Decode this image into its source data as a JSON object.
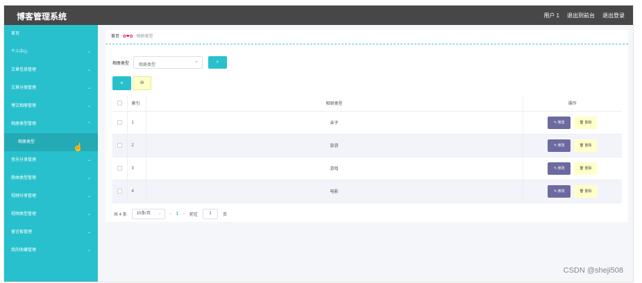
{
  "app": {
    "title": "博客管理系统"
  },
  "header": {
    "user": "用户 1",
    "back_label": "退出到前台",
    "logout_label": "退出登录"
  },
  "sidebar": {
    "items": [
      {
        "label": "首页",
        "has_chevron": false
      },
      {
        "label": "个人中心",
        "has_chevron": true,
        "chevron": "⌄"
      },
      {
        "label": "文章信息管理",
        "has_chevron": true,
        "chevron": "⌄"
      },
      {
        "label": "文章分类管理",
        "has_chevron": true,
        "chevron": "⌄"
      },
      {
        "label": "博文相册管理",
        "has_chevron": true,
        "chevron": "⌄"
      },
      {
        "label": "相册类型管理",
        "has_chevron": true,
        "chevron": "⌃"
      },
      {
        "label": "相册类型",
        "sub": true
      },
      {
        "label": "音乐分享管理",
        "has_chevron": true,
        "chevron": "⌄"
      },
      {
        "label": "歌曲类型管理",
        "has_chevron": true,
        "chevron": "⌄"
      },
      {
        "label": "视频分享管理",
        "has_chevron": true,
        "chevron": "⌄"
      },
      {
        "label": "视频类型管理",
        "has_chevron": true,
        "chevron": "⌄"
      },
      {
        "label": "留言板管理",
        "has_chevron": true,
        "chevron": "⌄"
      },
      {
        "label": "我的收藏管理",
        "has_chevron": true,
        "chevron": "⌄"
      }
    ]
  },
  "breadcrumb": {
    "home": "首页",
    "separator": "✿❤✿",
    "current": "相册类型"
  },
  "search": {
    "label": "相册类型",
    "placeholder": "相册类型",
    "icon": "search-icon"
  },
  "toolbar": {
    "add_label": "+",
    "delete_label": "⊜"
  },
  "table": {
    "headers": {
      "index": "索引",
      "type": "相册类型",
      "action": "操作"
    },
    "rows": [
      {
        "index": "1",
        "type": "亲子"
      },
      {
        "index": "2",
        "type": "旅游"
      },
      {
        "index": "3",
        "type": "游戏"
      },
      {
        "index": "4",
        "type": "电影"
      }
    ],
    "edit_label": "✎ 修改",
    "remove_label": "🗑 删除"
  },
  "pagination": {
    "total": "共 4 条",
    "page_size": "10条/页",
    "prev": "‹",
    "current_page": "1",
    "next": "›",
    "goto_label": "前往",
    "goto_value": "1",
    "page_suffix": "页"
  },
  "watermark": "CSDN @sheji508",
  "colors": {
    "accent": "#28c0cc",
    "header": "#474747",
    "edit": "#6d6aa0",
    "remove": "#ffffc8"
  }
}
